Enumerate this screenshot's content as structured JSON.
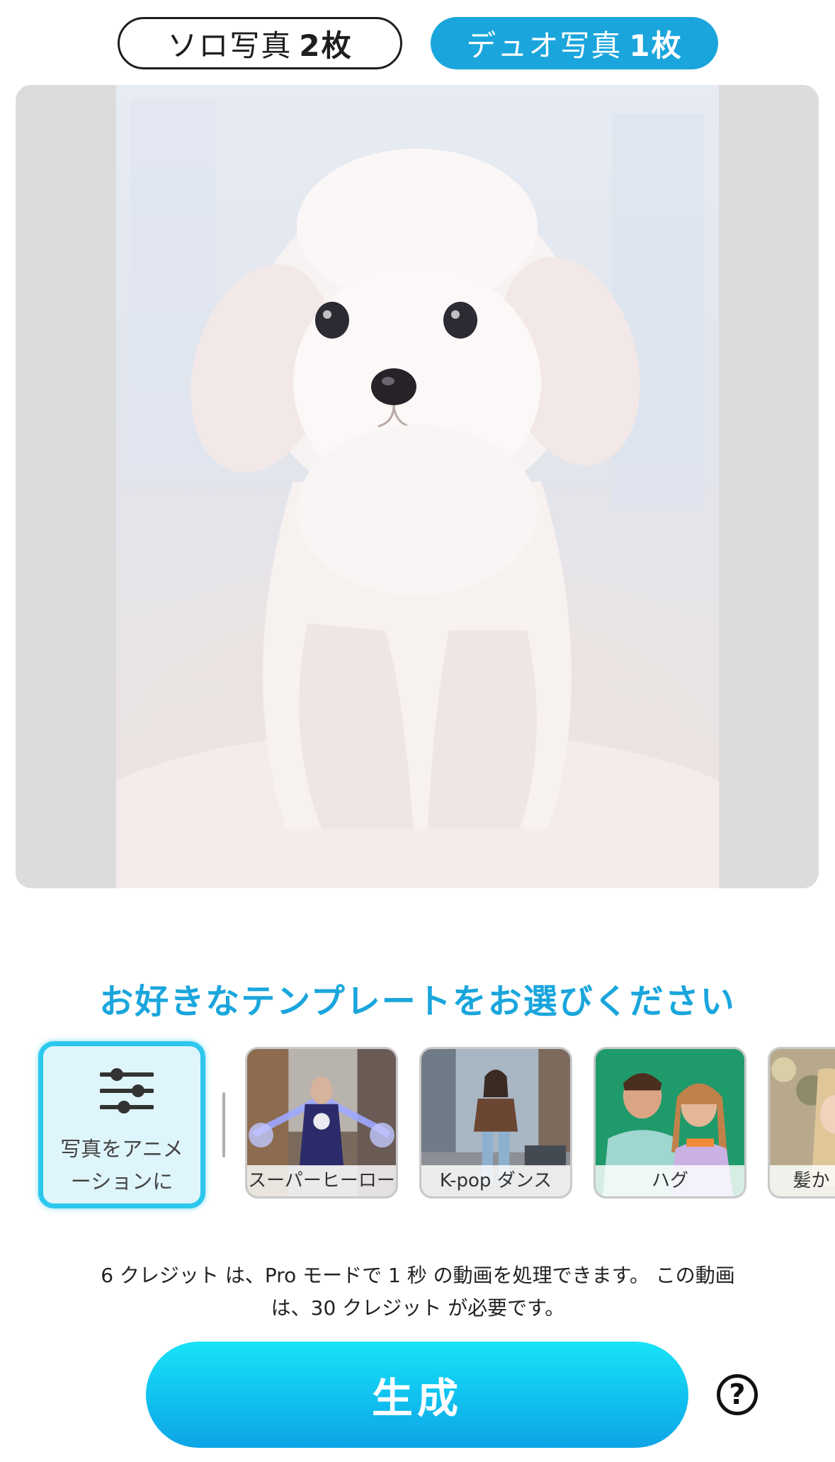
{
  "mode_tabs": {
    "solo": {
      "label": "ソロ写真",
      "count": "2枚"
    },
    "duo": {
      "label": "デュオ写真",
      "count": "1枚"
    }
  },
  "photo": {
    "icon": "image-icon"
  },
  "template_heading": "お好きなテンプレートをお選びください",
  "animate_card": {
    "icon": "sliders-icon",
    "label_line1": "写真をアニメ",
    "label_line2": "ーションに"
  },
  "templates": [
    {
      "label": "スーパーヒーロー"
    },
    {
      "label": "K-pop ダンス"
    },
    {
      "label": "ハグ"
    },
    {
      "label": "髪か"
    }
  ],
  "credits": {
    "line1": "6 クレジット は、Pro モードで 1 秒 の動画を処理できます。 この動画",
    "line2": "は、30 クレジット が必要です。"
  },
  "generate_label": "生成",
  "help_label": "?",
  "colors": {
    "accent": "#1aa6dc",
    "button_top": "#18e3f6",
    "button_bottom": "#0ea4e6"
  }
}
